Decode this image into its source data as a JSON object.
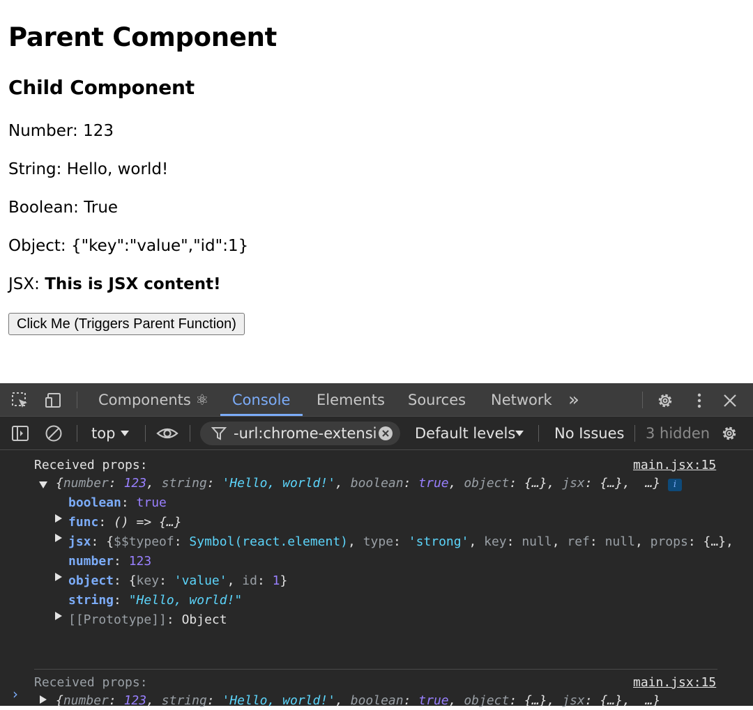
{
  "app": {
    "h1": "Parent Component",
    "h2": "Child Component",
    "lines": [
      {
        "label": "Number:",
        "value": "123"
      },
      {
        "label": "String:",
        "value": "Hello, world!"
      },
      {
        "label": "Boolean:",
        "value": "True"
      },
      {
        "label": "Object:",
        "value": "{\"key\":\"value\",\"id\":1}"
      }
    ],
    "jsx_label": "JSX:",
    "jsx_value": "This is JSX content!",
    "button_label": "Click Me (Triggers Parent Function)"
  },
  "devtools": {
    "tabs": [
      "Components ⚛",
      "Console",
      "Elements",
      "Sources",
      "Network"
    ],
    "active_tab": "Console",
    "more_tabs": "»",
    "context": "top",
    "filter_text": "-url:chrome-extensio",
    "levels": "Default levels",
    "issues": "No Issues",
    "hidden": "3 hidden",
    "colors": {
      "accent": "#7cacf8",
      "background": "#282828",
      "tabbar": "#3c3c3c",
      "string": "#5cd5fb",
      "number": "#9980ff"
    }
  },
  "console": {
    "source_link": "main.jsx:15",
    "msg1": {
      "title": "Received props:",
      "summary": {
        "k1": "number",
        "v1": "123",
        "k2": "string",
        "v2": "'Hello, world!'",
        "k3": "boolean",
        "v3": "true",
        "k4": "object",
        "v4": "{…}",
        "k5": "jsx",
        "v5": "{…}",
        "tail": "…}"
      },
      "info": "i",
      "rows": {
        "boolean_key": "boolean",
        "boolean_val": "true",
        "func_key": "func",
        "func_val": "() => {…}",
        "jsx_key": "jsx",
        "jsx_typeof_key": "$$typeof",
        "jsx_typeof_val": "Symbol(react.element)",
        "jsx_type_key": "type",
        "jsx_type_val": "'strong'",
        "jsx_key_key": "key",
        "jsx_key_val": "null",
        "jsx_ref_key": "ref",
        "jsx_ref_val": "null",
        "jsx_props_key": "props",
        "jsx_props_val": "{…},",
        "number_key": "number",
        "number_val": "123",
        "object_key": "object",
        "object_k1": "key",
        "object_v1": "'value'",
        "object_k2": "id",
        "object_v2": "1",
        "string_key": "string",
        "string_val": "\"Hello, world!\"",
        "proto_key": "[[Prototype]]",
        "proto_val": "Object"
      }
    },
    "msg2": {
      "title": "Received props:",
      "summary": {
        "k1": "number",
        "v1": "123",
        "k2": "string",
        "v2": "'Hello, world!'",
        "k3": "boolean",
        "v3": "true",
        "k4": "object",
        "v4": "{…}",
        "k5": "jsx",
        "v5": "{…}",
        "tail": "…}"
      }
    },
    "prompt": "›"
  }
}
